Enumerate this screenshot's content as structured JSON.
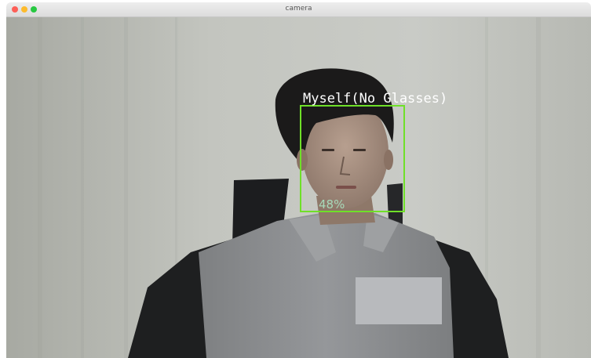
{
  "window": {
    "title": "camera"
  },
  "detection": {
    "label": "Myself(No Glasses)",
    "confidence": "48%",
    "box_color": "#6fe028"
  },
  "colors": {
    "wall": "#b9bbb4",
    "shirt_gray": "#8a8c8d",
    "shirt_black": "#1f1f20"
  },
  "icons": [
    "close-icon",
    "minimize-icon",
    "maximize-icon"
  ]
}
